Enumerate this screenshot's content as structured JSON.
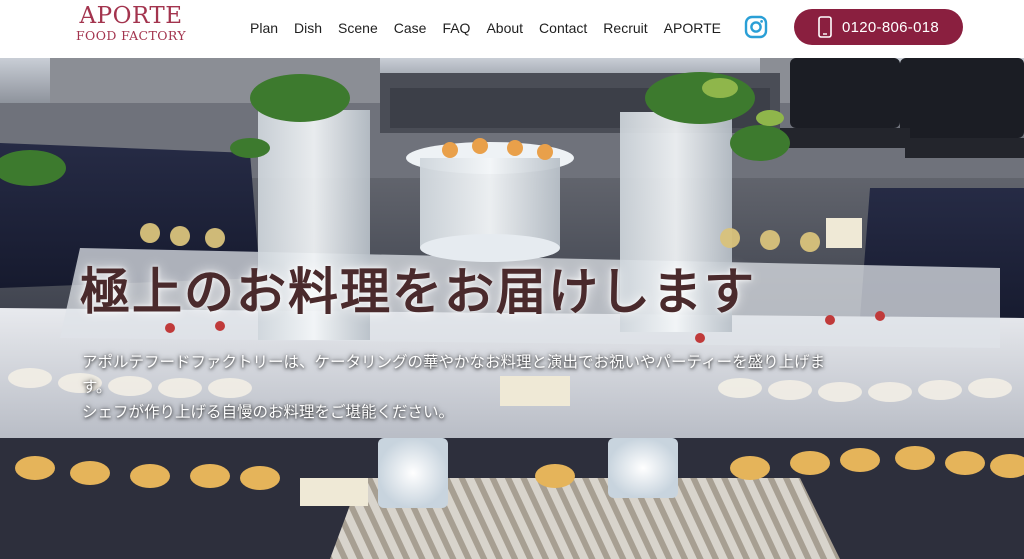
{
  "brand": {
    "line1": "APORTE",
    "line2": "FOOD FACTORY",
    "color": "#a3344e"
  },
  "nav": {
    "items": [
      {
        "label": "Plan"
      },
      {
        "label": "Dish"
      },
      {
        "label": "Scene"
      },
      {
        "label": "Case"
      },
      {
        "label": "FAQ"
      },
      {
        "label": "About"
      },
      {
        "label": "Contact"
      },
      {
        "label": "Recruit"
      },
      {
        "label": "APORTE"
      }
    ]
  },
  "social": {
    "icon": "instagram-icon",
    "color": "#2a9fd6"
  },
  "phone": {
    "number": "0120-806-018",
    "icon": "smartphone-icon",
    "bg_color": "#8a1f3f"
  },
  "hero": {
    "title": "極上のお料理をお届けします",
    "lines": [
      "アポルテフードファクトリーは、ケータリングの華やかなお料理と演出でお祝いやパーティーを盛り上げま",
      "す。",
      "シェフが作り上げる自慢のお料理をご堪能ください。"
    ]
  }
}
